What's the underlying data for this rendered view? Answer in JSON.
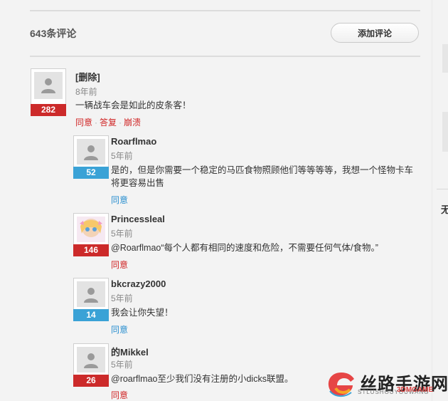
{
  "header": {
    "comment_count": "643条评论",
    "add_comment_label": "添加评论"
  },
  "sidebar_fragment": {
    "text": "无"
  },
  "comments": [
    {
      "author": "[删除]",
      "time": "8年前",
      "score": "282",
      "text": "一辆战车会是如此的皮条客！",
      "actions": [
        "同意",
        "答复",
        "崩溃"
      ]
    },
    {
      "author": "Roarflmao",
      "time": "5年前",
      "score": "52",
      "text": "是的，但是你需要一个稳定的马匹食物照顾他们等等等等，我想一个怪物卡车将更容易出售",
      "actions": [
        "同意"
      ]
    },
    {
      "author": "Princessleal",
      "time": "5年前",
      "score": "146",
      "text": "@Roarflmao“每个人都有相同的速度和危险，不需要任何气体/食物。”",
      "actions": [
        "同意"
      ]
    },
    {
      "author": "bkcrazy2000",
      "time": "5年前",
      "score": "14",
      "text": "我会让你失望！",
      "actions": [
        "同意"
      ]
    },
    {
      "author": "的Mikkel",
      "time": "5年前",
      "score": "26",
      "text": "@roarflmao至少我们没有注册的小dicks联盟。",
      "actions": [
        "同意"
      ]
    }
  ],
  "watermark": {
    "title": "丝路手游网",
    "sub_latin": "STLUSHOUYOUWANG",
    "sub_brand": "3DMGAME"
  },
  "colors": {
    "score_red": "#cc2a2a",
    "score_blue": "#3aa2d6",
    "action_red": "#d02525",
    "action_blue": "#2a8fcf"
  }
}
